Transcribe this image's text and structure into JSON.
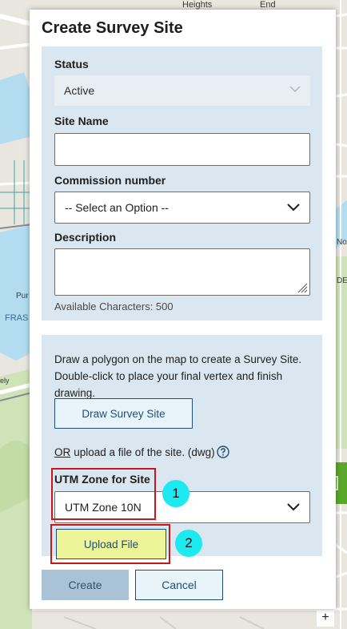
{
  "map": {
    "labels": [
      "Heights",
      "End",
      "Pur",
      "FRAS",
      "No",
      "DEL",
      "ely"
    ],
    "accent_colors": {
      "water": "#b3dcf0",
      "land": "#e8e6df",
      "park": "#cfe3b8",
      "road": "#ffffff"
    },
    "side_button_icon": "map-image-icon",
    "side_button_color": "#5aa82a",
    "zoom_in_label": "+"
  },
  "dialog": {
    "title": "Create Survey Site",
    "status": {
      "label": "Status",
      "value": "Active",
      "icon": "chevron-down-icon"
    },
    "site_name": {
      "label": "Site Name",
      "value": ""
    },
    "commission": {
      "label": "Commission number",
      "value": "-- Select an Option --",
      "icon": "chevron-down-icon"
    },
    "description": {
      "label": "Description",
      "value": "",
      "available": "Available Characters: 500"
    },
    "instructions": "Draw a polygon on the map to create a Survey Site. Double-click to place your final vertex and finish drawing.",
    "draw_button": "Draw Survey Site",
    "upload_or": "OR",
    "upload_text": "upload a file of the site. (dwg)",
    "help_icon": "question-circle-icon",
    "utm": {
      "label": "UTM Zone for Site",
      "value": "UTM Zone 10N",
      "icon": "chevron-down-icon"
    },
    "upload_button": "Upload File",
    "markers": [
      "1",
      "2"
    ],
    "create_button": "Create",
    "cancel_button": "Cancel",
    "colors": {
      "panel": "#dbe7f0",
      "highlight": "#c8161d",
      "marker": "#1de9f0",
      "upload_button_bg": "#eef599",
      "primary_text": "#1f4e79"
    }
  }
}
